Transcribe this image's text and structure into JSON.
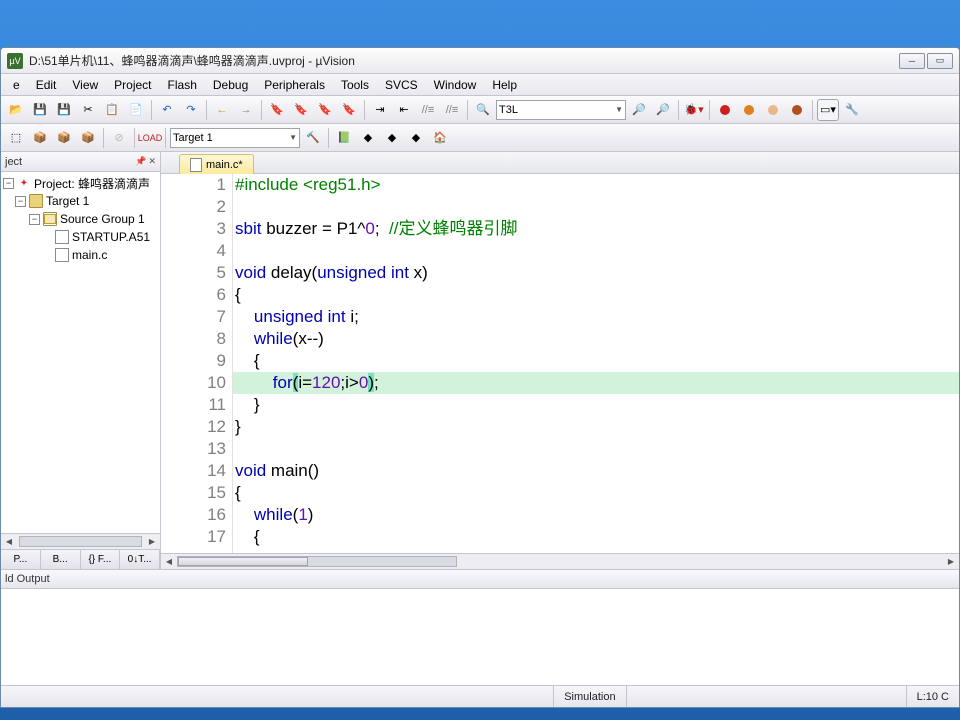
{
  "window": {
    "title": "D:\\51单片机\\11、蜂鸣器滴滴声\\蜂鸣器滴滴声.uvproj - µVision",
    "min": "─",
    "max": "▭",
    "close": "✕"
  },
  "menu": {
    "file": "e",
    "edit": "Edit",
    "view": "View",
    "project": "Project",
    "flash": "Flash",
    "debug": "Debug",
    "peripherals": "Peripherals",
    "tools": "Tools",
    "svcs": "SVCS",
    "window": "Window",
    "help": "Help"
  },
  "toolbar": {
    "find_text": "T3L"
  },
  "toolbar2": {
    "target": "Target 1"
  },
  "project_panel": {
    "title": "ject",
    "root": "Project: 蜂鸣器滴滴声",
    "target": "Target 1",
    "group": "Source Group 1",
    "files": [
      "STARTUP.A51",
      "main.c"
    ],
    "tabs": [
      "P...",
      "B...",
      "{} F...",
      "0↓T..."
    ]
  },
  "editor": {
    "tab": "main.c*",
    "lines": [
      {
        "n": "1",
        "segs": [
          {
            "t": "#include <reg51.h>",
            "c": "k-green"
          }
        ]
      },
      {
        "n": "2",
        "segs": [
          {
            "t": " "
          }
        ]
      },
      {
        "n": "3",
        "segs": [
          {
            "t": "sbit",
            "c": "k-blue"
          },
          {
            "t": " buzzer = P1^"
          },
          {
            "t": "0",
            "c": "k-pur"
          },
          {
            "t": ";  "
          },
          {
            "t": "//定义蜂鸣器引脚",
            "c": "k-green"
          }
        ]
      },
      {
        "n": "4",
        "segs": [
          {
            "t": " "
          }
        ]
      },
      {
        "n": "5",
        "segs": [
          {
            "t": "void",
            "c": "k-blue"
          },
          {
            "t": " delay("
          },
          {
            "t": "unsigned",
            "c": "k-blue"
          },
          {
            "t": " "
          },
          {
            "t": "int",
            "c": "k-blue"
          },
          {
            "t": " x)"
          }
        ]
      },
      {
        "n": "6",
        "segs": [
          {
            "t": "{"
          }
        ]
      },
      {
        "n": "7",
        "segs": [
          {
            "t": "    "
          },
          {
            "t": "unsigned",
            "c": "k-blue"
          },
          {
            "t": " "
          },
          {
            "t": "int",
            "c": "k-blue"
          },
          {
            "t": " i;"
          }
        ]
      },
      {
        "n": "8",
        "segs": [
          {
            "t": "    "
          },
          {
            "t": "while",
            "c": "k-blue"
          },
          {
            "t": "(x--)"
          }
        ]
      },
      {
        "n": "9",
        "segs": [
          {
            "t": "    {"
          }
        ]
      },
      {
        "n": "10",
        "hl": true,
        "segs": [
          {
            "t": "        "
          },
          {
            "t": "for",
            "c": "k-blue"
          },
          {
            "t": "(",
            "c": "bracket-hl"
          },
          {
            "t": "i="
          },
          {
            "t": "120",
            "c": "k-pur"
          },
          {
            "t": ";i>"
          },
          {
            "t": "0",
            "c": "k-pur"
          },
          {
            "t": ")",
            "c": "bracket-hl"
          },
          {
            "t": ";"
          }
        ]
      },
      {
        "n": "11",
        "segs": [
          {
            "t": "    }"
          }
        ]
      },
      {
        "n": "12",
        "segs": [
          {
            "t": "}"
          }
        ]
      },
      {
        "n": "13",
        "segs": [
          {
            "t": " "
          }
        ]
      },
      {
        "n": "14",
        "segs": [
          {
            "t": "void",
            "c": "k-blue"
          },
          {
            "t": " main()"
          }
        ]
      },
      {
        "n": "15",
        "segs": [
          {
            "t": "{"
          }
        ]
      },
      {
        "n": "16",
        "segs": [
          {
            "t": "    "
          },
          {
            "t": "while",
            "c": "k-blue"
          },
          {
            "t": "("
          },
          {
            "t": "1",
            "c": "k-pur"
          },
          {
            "t": ")"
          }
        ]
      },
      {
        "n": "17",
        "segs": [
          {
            "t": "    {"
          }
        ]
      }
    ]
  },
  "output": {
    "title": "ld Output"
  },
  "status": {
    "sim": "Simulation",
    "pos": "L:10 C"
  }
}
